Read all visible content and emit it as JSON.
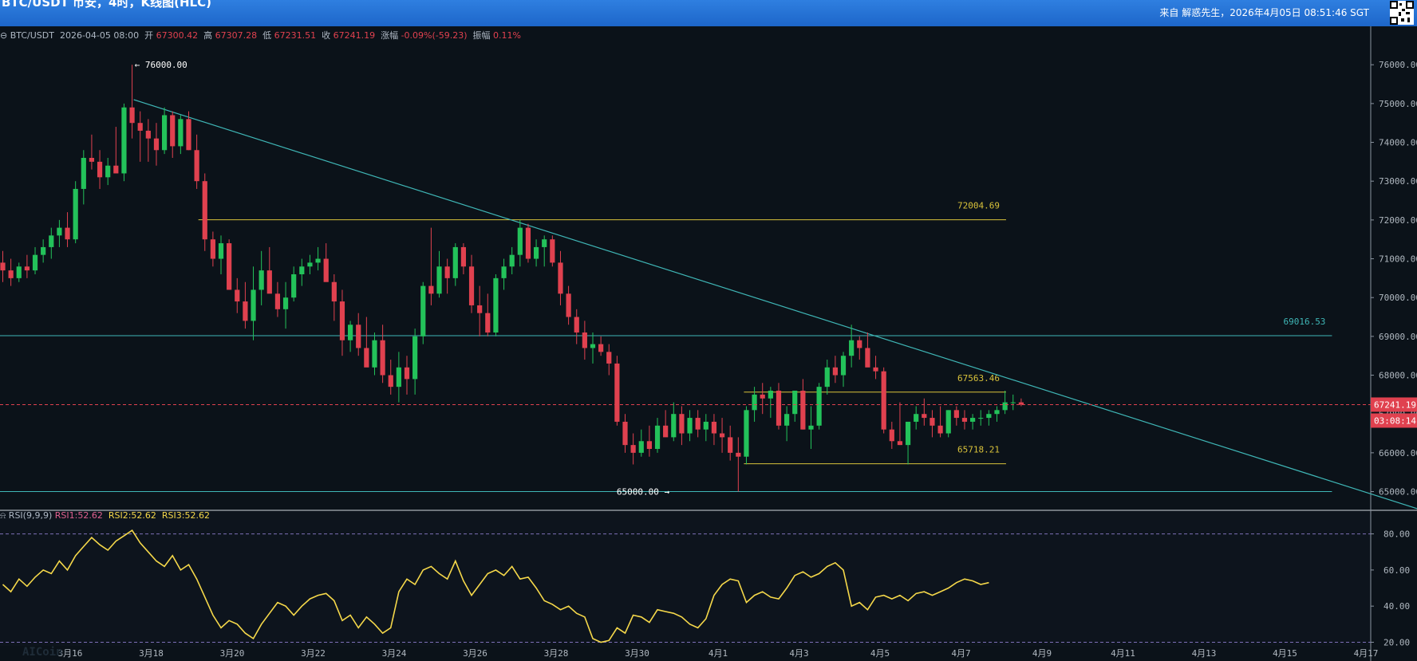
{
  "header": {
    "title": "BTC/USDT 币安，4时，K线图(HLC)",
    "source": "来自 解惑先生，2026年4月05日 08:51:46 SGT"
  },
  "info_bar": {
    "symbol": "BTC/USDT",
    "datetime": "2026-04-05 08:00",
    "open_label": "开",
    "open": "67300.42",
    "high_label": "高",
    "high": "67307.28",
    "low_label": "低",
    "low": "67231.51",
    "close_label": "收",
    "close": "67241.19",
    "change_label": "涨幅",
    "change": "-0.09%(-59.23)",
    "amplitude_label": "振幅",
    "amplitude": "0.11%"
  },
  "rsi_bar": {
    "name": "RSI(9,9,9)",
    "rsi1": "RSI1:52.62",
    "rsi2": "RSI2:52.62",
    "rsi3": "RSI3:52.62"
  },
  "price_tag": {
    "value": "67241.19",
    "countdown": "03:08:14"
  },
  "annotations": {
    "high": "76000.00",
    "low": "65000.00"
  },
  "colors": {
    "up": "#23c25a",
    "down": "#e0414f",
    "level": "#d9c23a",
    "trend": "#3fb6b6",
    "rsi": "#f5d84a",
    "axis_text": "#b0b8c0",
    "background": "#0b1219"
  },
  "chart_data": [
    {
      "type": "candlestick",
      "yaxis_ticks": [
        "76000.00",
        "75000.00",
        "74000.00",
        "73000.00",
        "72000.00",
        "71000.00",
        "70000.00",
        "69000.00",
        "68000.00",
        "67000.00",
        "66000.00",
        "65000.00"
      ],
      "ylim": [
        64600,
        76600
      ],
      "xaxis_ticks": [
        "3月16",
        "3月18",
        "3月20",
        "3月22",
        "3月24",
        "3月26",
        "3月28",
        "3月30",
        "4月1",
        "4月3",
        "4月5",
        "4月7",
        "4月9",
        "4月11",
        "4月13",
        "4月15",
        "4月17"
      ],
      "candles": [
        [
          70900,
          71200,
          70400,
          70700
        ],
        [
          70700,
          71000,
          70300,
          70500
        ],
        [
          70500,
          70900,
          70400,
          70800
        ],
        [
          70800,
          71100,
          70500,
          70700
        ],
        [
          70700,
          71300,
          70600,
          71100
        ],
        [
          71100,
          71500,
          70900,
          71300
        ],
        [
          71300,
          71800,
          71000,
          71600
        ],
        [
          71600,
          72000,
          71300,
          71800
        ],
        [
          71800,
          72200,
          71300,
          71500
        ],
        [
          71500,
          73000,
          71400,
          72800
        ],
        [
          72800,
          73800,
          72400,
          73600
        ],
        [
          73600,
          74200,
          73300,
          73500
        ],
        [
          73500,
          73800,
          72800,
          73100
        ],
        [
          73100,
          73600,
          72900,
          73400
        ],
        [
          73400,
          74400,
          73200,
          73200
        ],
        [
          73200,
          75000,
          73000,
          74900
        ],
        [
          74900,
          76000,
          74100,
          74500
        ],
        [
          74500,
          74800,
          73500,
          74300
        ],
        [
          74300,
          74600,
          73500,
          74100
        ],
        [
          74100,
          74500,
          73400,
          73800
        ],
        [
          73800,
          74900,
          73700,
          74700
        ],
        [
          74700,
          74800,
          73600,
          73900
        ],
        [
          73900,
          74700,
          73700,
          74600
        ],
        [
          74600,
          74800,
          73800,
          73800
        ],
        [
          73800,
          74200,
          72800,
          73000
        ],
        [
          73000,
          73200,
          71200,
          71500
        ],
        [
          71500,
          71700,
          70800,
          71000
        ],
        [
          71000,
          71600,
          70600,
          71400
        ],
        [
          71400,
          71500,
          70200,
          70200
        ],
        [
          70200,
          70500,
          69600,
          69900
        ],
        [
          69900,
          70400,
          69200,
          69400
        ],
        [
          69400,
          70800,
          68900,
          70200
        ],
        [
          70200,
          71200,
          69800,
          70700
        ],
        [
          70700,
          71300,
          70200,
          70100
        ],
        [
          70100,
          70400,
          69500,
          69700
        ],
        [
          69700,
          70400,
          69200,
          70000
        ],
        [
          70000,
          70800,
          69900,
          70600
        ],
        [
          70600,
          71000,
          70300,
          70800
        ],
        [
          70800,
          71100,
          70600,
          70900
        ],
        [
          70900,
          71300,
          70700,
          71000
        ],
        [
          71000,
          71400,
          70500,
          70400
        ],
        [
          70400,
          70600,
          69400,
          69900
        ],
        [
          69900,
          70200,
          68500,
          68900
        ],
        [
          68900,
          69400,
          68600,
          69300
        ],
        [
          69300,
          69600,
          68500,
          68700
        ],
        [
          68700,
          69500,
          68400,
          68200
        ],
        [
          68200,
          69100,
          68000,
          68900
        ],
        [
          68900,
          69300,
          67800,
          68000
        ],
        [
          68000,
          68400,
          67500,
          67700
        ],
        [
          67700,
          68600,
          67300,
          68200
        ],
        [
          68200,
          68500,
          67500,
          67900
        ],
        [
          67900,
          69200,
          67500,
          69000
        ],
        [
          69000,
          70400,
          68800,
          70300
        ],
        [
          70300,
          71800,
          69800,
          70100
        ],
        [
          70100,
          71200,
          70000,
          70800
        ],
        [
          70800,
          71000,
          70100,
          70500
        ],
        [
          70500,
          71400,
          70300,
          71300
        ],
        [
          71300,
          71400,
          70600,
          70800
        ],
        [
          70800,
          71100,
          69600,
          69800
        ],
        [
          69800,
          70300,
          69000,
          69600
        ],
        [
          69600,
          70100,
          69000,
          69100
        ],
        [
          69100,
          70600,
          69000,
          70500
        ],
        [
          70500,
          71000,
          70200,
          70800
        ],
        [
          70800,
          71300,
          70600,
          71100
        ],
        [
          71100,
          72000,
          70800,
          71800
        ],
        [
          71800,
          71900,
          70900,
          71000
        ],
        [
          71000,
          71500,
          70800,
          71300
        ],
        [
          71300,
          71600,
          70800,
          71500
        ],
        [
          71500,
          71600,
          70800,
          70900
        ],
        [
          70900,
          71200,
          69800,
          70100
        ],
        [
          70100,
          70300,
          69300,
          69500
        ],
        [
          69500,
          69700,
          68800,
          69100
        ],
        [
          69100,
          69400,
          68400,
          68700
        ],
        [
          68700,
          69100,
          68300,
          68800
        ],
        [
          68800,
          69000,
          68500,
          68600
        ],
        [
          68600,
          68800,
          68000,
          68300
        ],
        [
          68300,
          68500,
          66700,
          66800
        ],
        [
          66800,
          67000,
          66000,
          66200
        ],
        [
          66200,
          66500,
          65700,
          66000
        ],
        [
          66000,
          66600,
          65900,
          66300
        ],
        [
          66300,
          66700,
          65900,
          66100
        ],
        [
          66100,
          66900,
          66000,
          66700
        ],
        [
          66700,
          67100,
          66500,
          66400
        ],
        [
          66400,
          67300,
          66300,
          67000
        ],
        [
          67000,
          67200,
          66200,
          66500
        ],
        [
          66500,
          67100,
          66300,
          66900
        ],
        [
          66900,
          67100,
          66400,
          66600
        ],
        [
          66600,
          67000,
          66300,
          66800
        ],
        [
          66800,
          67000,
          66200,
          66500
        ],
        [
          66500,
          66900,
          66000,
          66400
        ],
        [
          66400,
          66700,
          65800,
          66000
        ],
        [
          66000,
          66400,
          65000,
          65900
        ],
        [
          65900,
          67200,
          65700,
          67100
        ],
        [
          67100,
          67700,
          66800,
          67500
        ],
        [
          67500,
          67800,
          67000,
          67400
        ],
        [
          67400,
          67700,
          66900,
          67600
        ],
        [
          67600,
          67800,
          66600,
          66700
        ],
        [
          66700,
          67200,
          66300,
          67000
        ],
        [
          67000,
          67500,
          66800,
          67600
        ],
        [
          67600,
          67900,
          66600,
          66600
        ],
        [
          66600,
          67200,
          66100,
          66700
        ],
        [
          66700,
          67800,
          66600,
          67700
        ],
        [
          67700,
          68400,
          67500,
          68200
        ],
        [
          68200,
          68500,
          67800,
          68000
        ],
        [
          68000,
          68600,
          67700,
          68500
        ],
        [
          68500,
          69300,
          68200,
          68900
        ],
        [
          68900,
          69000,
          68400,
          68700
        ],
        [
          68700,
          69100,
          68300,
          68200
        ],
        [
          68200,
          68500,
          67900,
          68100
        ],
        [
          68100,
          68200,
          66500,
          66600
        ],
        [
          66600,
          66800,
          66100,
          66300
        ],
        [
          66300,
          67300,
          66200,
          66200
        ],
        [
          66200,
          66600,
          65700,
          66800
        ],
        [
          66800,
          67200,
          66600,
          67000
        ],
        [
          67000,
          67400,
          66700,
          66900
        ],
        [
          66900,
          67100,
          66400,
          66700
        ],
        [
          66700,
          67200,
          66400,
          66500
        ],
        [
          66500,
          67100,
          66400,
          67100
        ],
        [
          67100,
          67200,
          66700,
          66900
        ],
        [
          66900,
          67100,
          66600,
          66800
        ],
        [
          66800,
          67000,
          66600,
          66900
        ],
        [
          66900,
          67100,
          66700,
          66900
        ],
        [
          66900,
          67100,
          66700,
          67000
        ],
        [
          67000,
          67200,
          66800,
          67100
        ],
        [
          67100,
          67600,
          67000,
          67300
        ],
        [
          67300,
          67500,
          67100,
          67300
        ],
        [
          67300,
          67400,
          67200,
          67240
        ]
      ],
      "levels": [
        {
          "value": 72004.69,
          "label": "72004.69",
          "color": "level",
          "from": 0.14,
          "to": 0.71
        },
        {
          "value": 69016.53,
          "label": "69016.53",
          "color": "trend",
          "from": 0.0,
          "to": 0.94
        },
        {
          "value": 67563.46,
          "label": "67563.46",
          "color": "level",
          "from": 0.525,
          "to": 0.71
        },
        {
          "value": 65718.21,
          "label": "65718.21",
          "color": "level",
          "from": 0.525,
          "to": 0.71
        },
        {
          "value": 65000.0,
          "label": "",
          "color": "trend",
          "from": 0.0,
          "to": 0.94
        }
      ],
      "trendline": {
        "start": [
          16.5,
          75100
        ],
        "end": [
          76.5,
          64500
        ]
      }
    },
    {
      "type": "line",
      "series": [
        {
          "name": "RSI1",
          "values": [
            52,
            48,
            55,
            51,
            56,
            60,
            58,
            65,
            60,
            68,
            73,
            78,
            74,
            71,
            76,
            79,
            82,
            75,
            70,
            65,
            62,
            68,
            60,
            63,
            55,
            45,
            35,
            28,
            32,
            30,
            25,
            22,
            30,
            36,
            42,
            40,
            35,
            40,
            44,
            46,
            47,
            43,
            32,
            35,
            28,
            34,
            30,
            25,
            28,
            48,
            55,
            52,
            60,
            62,
            58,
            55,
            65,
            54,
            46,
            52,
            58,
            60,
            57,
            62,
            55,
            56,
            50,
            43,
            41,
            38,
            40,
            36,
            34,
            22,
            20,
            21,
            28,
            25,
            35,
            34,
            31,
            38,
            37,
            36,
            34,
            30,
            28,
            33,
            46,
            52,
            55,
            54,
            42,
            46,
            48,
            45,
            44,
            50,
            57,
            59,
            56,
            58,
            62,
            64,
            60,
            40,
            42,
            38,
            45,
            46,
            44,
            46,
            43,
            47,
            48,
            46,
            48,
            50,
            53,
            55,
            54,
            52,
            53
          ]
        }
      ],
      "yaxis_ticks": [
        "80.00",
        "60.00",
        "40.00",
        "20.00"
      ],
      "ylim": [
        18,
        86
      ],
      "guides": [
        80,
        20
      ]
    }
  ]
}
